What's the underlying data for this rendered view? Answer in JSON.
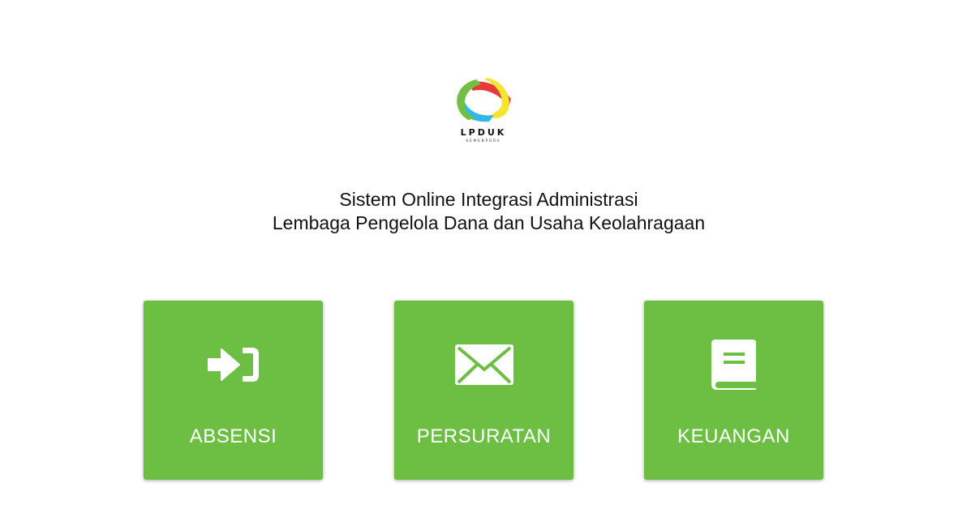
{
  "logo": {
    "name": "LPDUK",
    "subtitle": "KEMENPORA"
  },
  "header": {
    "line1": "Sistem Online Integrasi Administrasi",
    "line2": "Lembaga Pengelola Dana dan Usaha Keolahragaan"
  },
  "menu": [
    {
      "label": "ABSENSI",
      "icon": "sign-in-icon"
    },
    {
      "label": "PERSURATAN",
      "icon": "envelope-icon"
    },
    {
      "label": "KEUANGAN",
      "icon": "book-icon"
    }
  ],
  "colors": {
    "tile_bg": "#6dbf44",
    "tile_text": "#ffffff",
    "logo_red": "#e63a35",
    "logo_yellow": "#f5e531",
    "logo_blue": "#33b6e8",
    "logo_green": "#72bf44"
  }
}
